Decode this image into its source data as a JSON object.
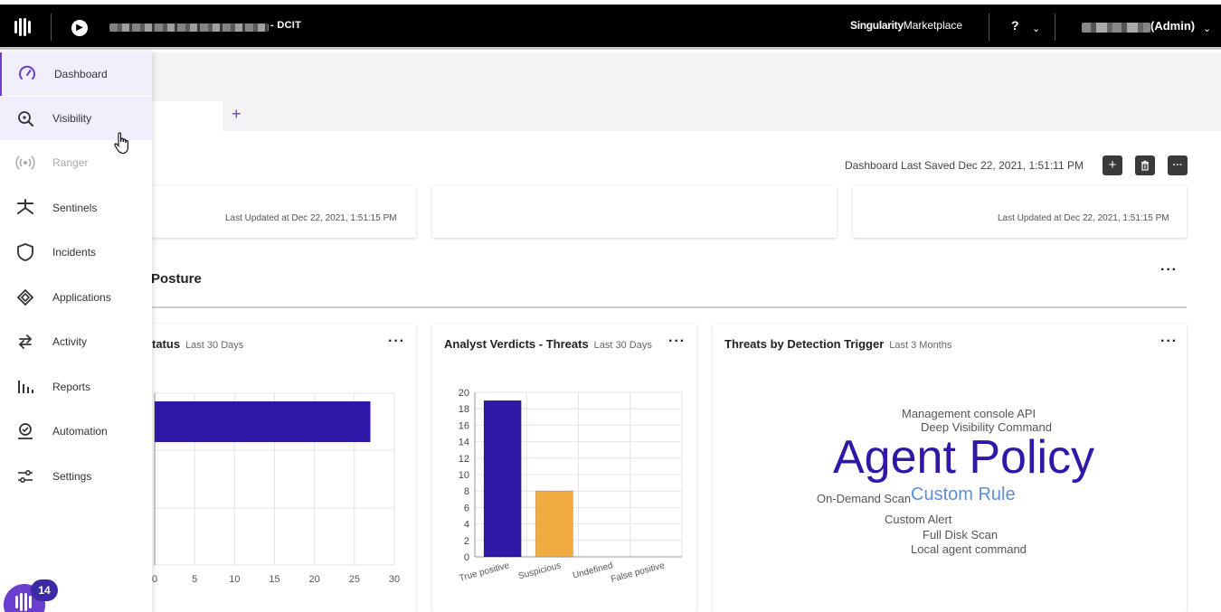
{
  "topbar": {
    "site_name": "- DCIT",
    "marketplace_bold": "Singularity",
    "marketplace_rest": "Marketplace",
    "help_label": "?",
    "user_role": "(Admin)"
  },
  "sidebar": {
    "items": [
      {
        "label": "Dashboard",
        "icon": "gauge-icon"
      },
      {
        "label": "Visibility",
        "icon": "search-icon"
      },
      {
        "label": "Ranger",
        "icon": "signal-icon"
      },
      {
        "label": "Sentinels",
        "icon": "asterisk-icon"
      },
      {
        "label": "Incidents",
        "icon": "shield-icon"
      },
      {
        "label": "Applications",
        "icon": "diamond-icon"
      },
      {
        "label": "Activity",
        "icon": "arrows-icon"
      },
      {
        "label": "Reports",
        "icon": "bar-chart-icon"
      },
      {
        "label": "Automation",
        "icon": "robot-icon"
      },
      {
        "label": "Settings",
        "icon": "sliders-icon"
      }
    ],
    "notification_count": "14"
  },
  "dashboard": {
    "add_tab": "+",
    "last_saved": "Dashboard Last Saved Dec 22, 2021, 1:51:11 PM",
    "toolbar": {
      "add": "+",
      "more": "···"
    },
    "card1_updated": "Last Updated at Dec 22, 2021, 1:51:15 PM",
    "card3_updated": "Last Updated at Dec 22, 2021, 1:51:15 PM",
    "section_title": "Posture",
    "more": "···"
  },
  "widgets": {
    "status": {
      "title": "tatus",
      "range": "Last 30 Days"
    },
    "verdicts": {
      "title": "Analyst Verdicts - Threats",
      "range": "Last 30 Days"
    },
    "triggers": {
      "title": "Threats by Detection Trigger",
      "range": "Last 3 Months"
    }
  },
  "colors": {
    "accent": "#6a3fd0",
    "bar_primary": "#3117a8",
    "bar_secondary": "#f0ab41",
    "wordcloud_light": "#5a8de0"
  },
  "chart_data": [
    {
      "type": "bar",
      "orientation": "horizontal",
      "x_ticks": [
        "0",
        "5",
        "10",
        "15",
        "20",
        "25",
        "30"
      ],
      "xlim": [
        0,
        30
      ],
      "values": [
        27
      ]
    },
    {
      "type": "bar",
      "categories": [
        "True positive",
        "Suspicious",
        "Undefined",
        "False positive"
      ],
      "values": [
        19,
        8,
        0,
        0
      ],
      "y_ticks": [
        "0",
        "2",
        "4",
        "6",
        "8",
        "10",
        "12",
        "14",
        "16",
        "18",
        "20"
      ],
      "ylim": [
        0,
        20
      ],
      "grid": true
    },
    {
      "type": "wordcloud",
      "words": [
        {
          "text": "Management console API",
          "weight": 1
        },
        {
          "text": "Deep Visibility Command",
          "weight": 1
        },
        {
          "text": "Agent Policy",
          "weight": 10
        },
        {
          "text": "On-Demand Scan",
          "weight": 1
        },
        {
          "text": "Custom Rule",
          "weight": 3
        },
        {
          "text": "Custom Alert",
          "weight": 1
        },
        {
          "text": "Full Disk Scan",
          "weight": 1
        },
        {
          "text": "Local agent command",
          "weight": 1
        }
      ]
    }
  ]
}
